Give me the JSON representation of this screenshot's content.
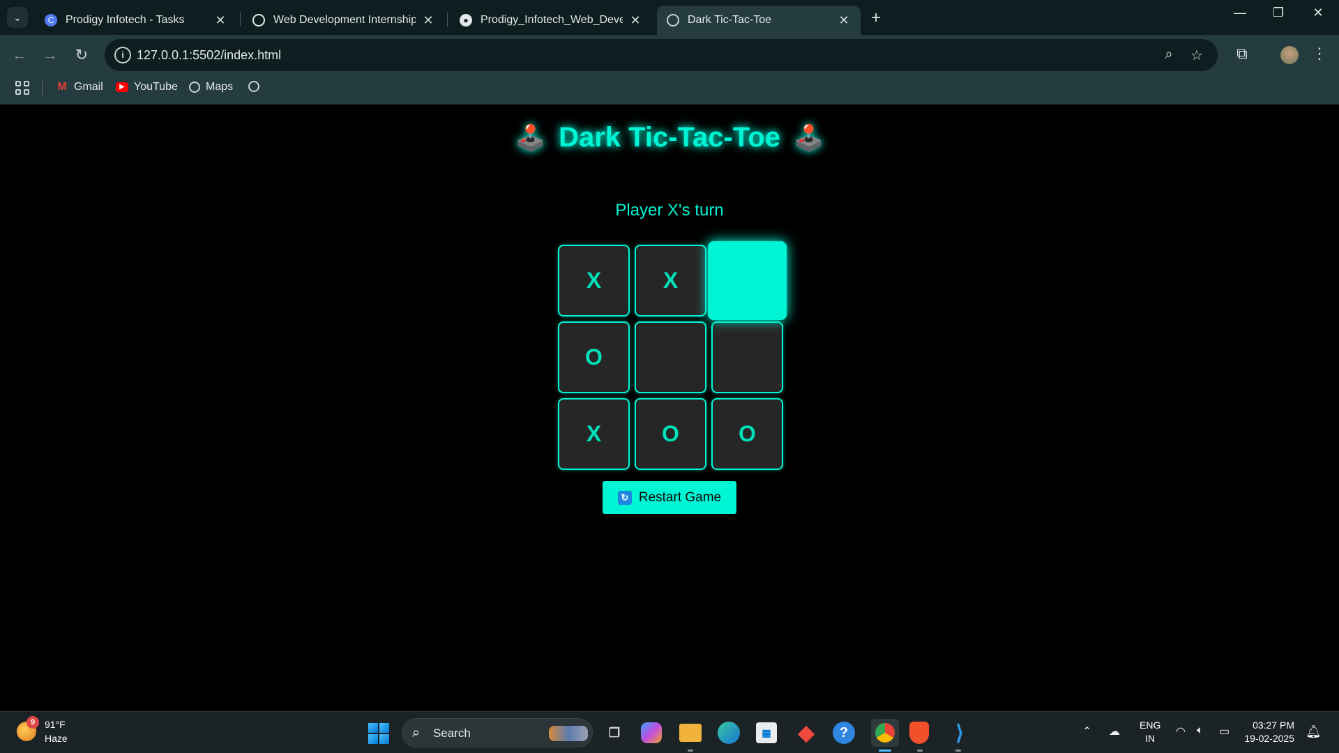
{
  "browser": {
    "tabs": [
      {
        "title": "Prodigy Infotech - Tasks",
        "favicon": "prodigy-icon",
        "active": false
      },
      {
        "title": "Web Development Internship S",
        "favicon": "openai-icon",
        "active": false
      },
      {
        "title": "Prodigy_Infotech_Web_Develop",
        "favicon": "github-icon",
        "active": false
      },
      {
        "title": "Dark Tic-Tac-Toe",
        "favicon": "globe-icon",
        "active": true
      }
    ],
    "url": "127.0.0.1:5502/index.html",
    "bookmarks": [
      {
        "label": "Gmail",
        "icon": "gmail-icon"
      },
      {
        "label": "YouTube",
        "icon": "youtube-icon"
      },
      {
        "label": "Maps",
        "icon": "maps-icon"
      },
      {
        "label": "",
        "icon": "globe-icon"
      }
    ]
  },
  "game": {
    "title": "Dark Tic-Tac-Toe",
    "title_icon": "joystick-icon",
    "status": "Player X's turn",
    "board": [
      "X",
      "X",
      "",
      "O",
      "",
      "",
      "X",
      "O",
      "O"
    ],
    "restart_label": "Restart Game",
    "accent_color": "#00f5d4"
  },
  "taskbar": {
    "weather": {
      "temp": "91°F",
      "condition": "Haze",
      "badge": "9"
    },
    "search_placeholder": "Search",
    "language": {
      "line1": "ENG",
      "line2": "IN"
    },
    "clock": {
      "time": "03:27 PM",
      "date": "19-02-2025"
    }
  }
}
